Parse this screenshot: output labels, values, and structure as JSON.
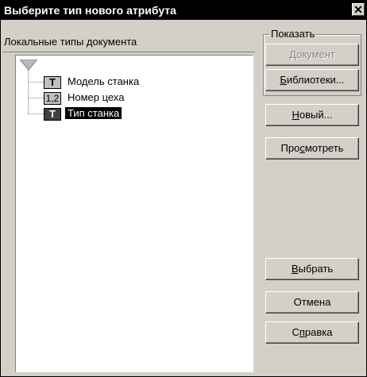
{
  "window": {
    "title": "Выберите тип нового атрибута",
    "close_glyph": "✕"
  },
  "list": {
    "label": "Локальные типы документа",
    "items": [
      {
        "icon_text": "T",
        "icon_kind": "text-type",
        "label": "Модель станка",
        "selected": false
      },
      {
        "icon_text": "1,2",
        "icon_kind": "number-type",
        "label": "Номер цеха",
        "selected": false
      },
      {
        "icon_text": "T",
        "icon_kind": "text-type",
        "label": "Тип станка",
        "selected": true
      }
    ]
  },
  "show_group": {
    "label": "Показать",
    "document_button": {
      "label_underlined": "Д",
      "label_rest": "окумент",
      "enabled": false
    },
    "libraries_button": {
      "label_underlined": "Б",
      "label_rest": "иблиотеки...",
      "enabled": true
    }
  },
  "buttons": {
    "new": {
      "label_underlined": "Н",
      "label_rest": "овый..."
    },
    "view": {
      "label_pre": "Про",
      "label_underlined": "с",
      "label_rest": "мотреть"
    },
    "select": {
      "label_underlined": "В",
      "label_rest": "ыбрать"
    },
    "cancel": {
      "label": "Отмена"
    },
    "help": {
      "label_pre": "С",
      "label_underlined": "п",
      "label_rest": "равка"
    }
  },
  "colors": {
    "face": "#d4d0c8",
    "title_bg": "#000000",
    "selection_bg": "#000000"
  }
}
